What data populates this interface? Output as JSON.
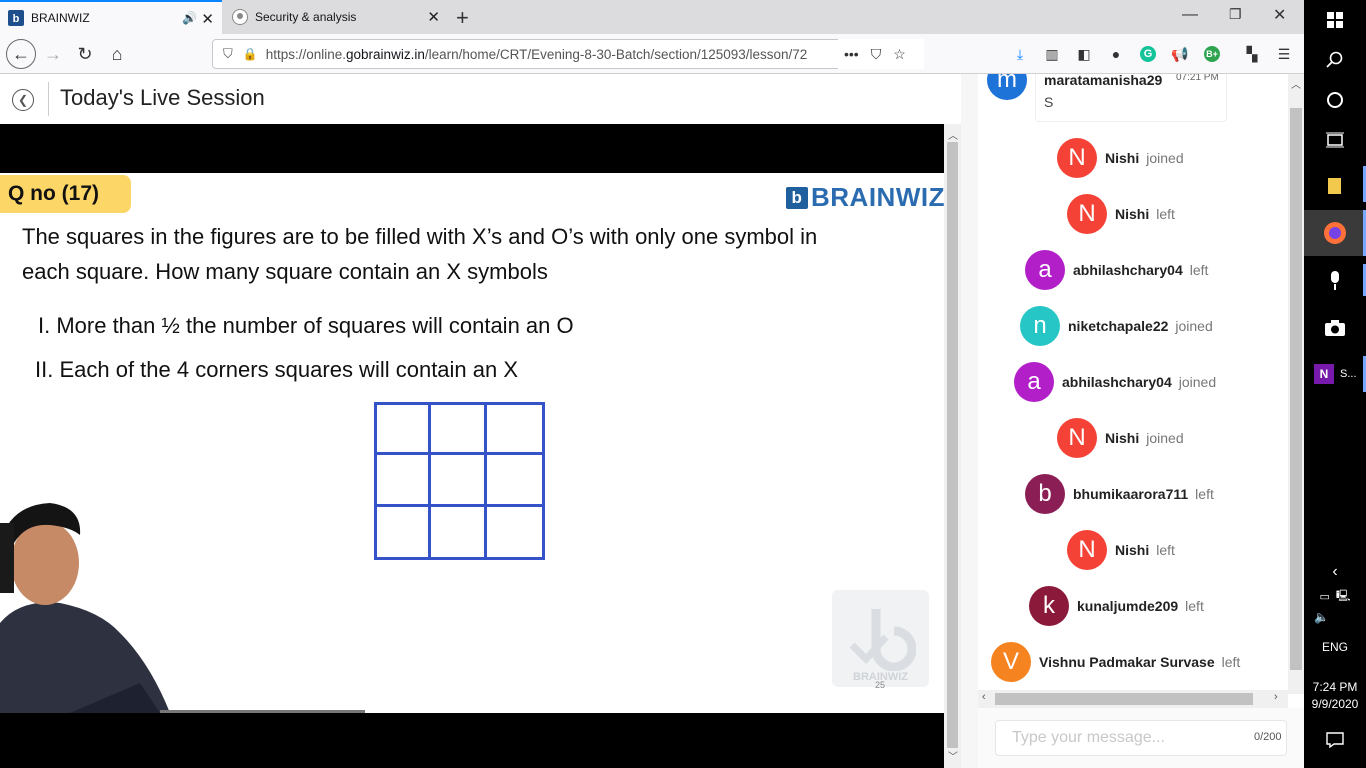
{
  "browser": {
    "tabs": [
      {
        "label": "BRAINWIZ",
        "icon": "brainwiz-favicon",
        "active": true,
        "audio_icon": "speaker-icon"
      },
      {
        "label": "Security & analysis",
        "icon": "github-favicon",
        "active": false
      }
    ],
    "new_tab_icon": "plus-icon",
    "url_prefix": "https://online.",
    "url_domain": "gobrainwiz.in",
    "url_path": "/learn/home/CRT/Evening-8-30-Batch/section/125093/lesson/72",
    "more_label": "•••"
  },
  "page": {
    "title": "Today's Live Session",
    "back_icon": "circle-chevron-left-icon"
  },
  "slide": {
    "qno": "Q no (17)",
    "logo_text": "BRAINWIZ",
    "logo_mark": "b",
    "line1": "The squares in the figures are to be filled with X’s and O’s with only one symbol in",
    "line2": "each square. How many square contain an X symbols",
    "statement1": "I. More than ½  the number of squares will contain an O",
    "statement2": "II. Each of the 4 corners squares will contain an X",
    "watermark_text": "BRAINWIZ",
    "page_number": "25"
  },
  "chat": {
    "top_message": {
      "avatar": "m",
      "avatar_color": "#1e73d8",
      "user": "maratamanisha29",
      "time": "07:21 PM",
      "text": "S"
    },
    "events": [
      {
        "avatar": "N",
        "color": "#f44336",
        "user": "Nishi",
        "action": "joined"
      },
      {
        "avatar": "N",
        "color": "#f44336",
        "user": "Nishi",
        "action": "left"
      },
      {
        "avatar": "a",
        "color": "#b21fc9",
        "user": "abhilashchary04",
        "action": "left"
      },
      {
        "avatar": "n",
        "color": "#26c6c6",
        "user": "niketchapale22",
        "action": "joined"
      },
      {
        "avatar": "a",
        "color": "#b21fc9",
        "user": "abhilashchary04",
        "action": "joined"
      },
      {
        "avatar": "N",
        "color": "#f44336",
        "user": "Nishi",
        "action": "joined"
      },
      {
        "avatar": "b",
        "color": "#8b1f55",
        "user": "bhumikaarora711",
        "action": "left"
      },
      {
        "avatar": "N",
        "color": "#f44336",
        "user": "Nishi",
        "action": "left"
      },
      {
        "avatar": "k",
        "color": "#8b1a3a",
        "user": "kunaljumde209",
        "action": "left"
      },
      {
        "avatar": "V",
        "color": "#f5831f",
        "user": "Vishnu Padmakar Survase",
        "action": "left"
      }
    ],
    "input_placeholder": "Type your message...",
    "char_count": "0/200"
  },
  "taskbar": {
    "time": "7:24 PM",
    "date": "9/9/2020",
    "lang": "ENG",
    "app_label": "S..."
  }
}
